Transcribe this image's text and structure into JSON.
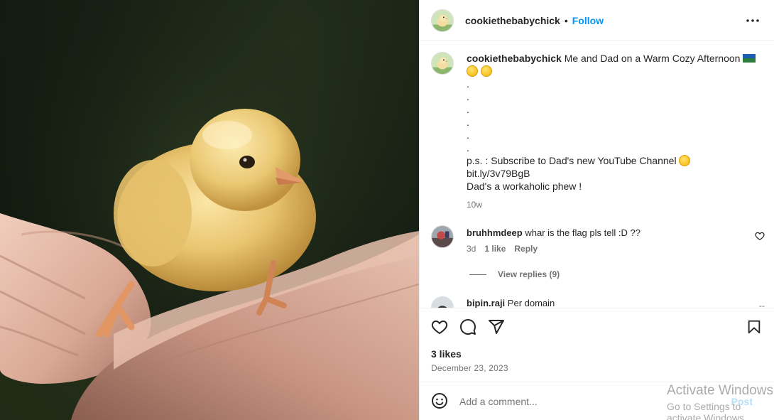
{
  "post": {
    "username": "cookiethebabychick",
    "follow_label": "Follow",
    "dot": "•",
    "caption": {
      "username": "cookiethebabychick",
      "text": "Me and Dad on a Warm Cozy Afternoon",
      "dots": [
        ".",
        ".",
        ".",
        ".",
        ".",
        "."
      ],
      "ps": "p.s. : Subscribe to Dad's new YouTube Channel",
      "link": "bit.ly/3v79BgB",
      "last_line": "Dad's a workaholic phew !",
      "time": "10w"
    },
    "comments": [
      {
        "username": "bruhhmdeep",
        "text": "whar is the flag pls tell :D ??",
        "time": "3d",
        "likes": "1 like",
        "reply_label": "Reply",
        "view_replies": "View replies (9)"
      },
      {
        "username": "bipin.raji",
        "text": "Per domain",
        "extra": "--"
      }
    ],
    "likes": "3 likes",
    "date": "December 23, 2023",
    "add_comment_placeholder": "Add a comment...",
    "post_label": "Post"
  },
  "watermark": {
    "line1": "Activate Windows",
    "line2": "Go to Settings to activate Windows."
  },
  "icons": {
    "more": "more-options-icon",
    "like": "heart-icon",
    "comment": "comment-icon",
    "share": "share-icon",
    "save": "bookmark-icon",
    "emoji": "smiley-icon"
  },
  "colors": {
    "accent": "#0095f6",
    "text": "#262626",
    "muted": "#737373",
    "border": "#efefef"
  }
}
